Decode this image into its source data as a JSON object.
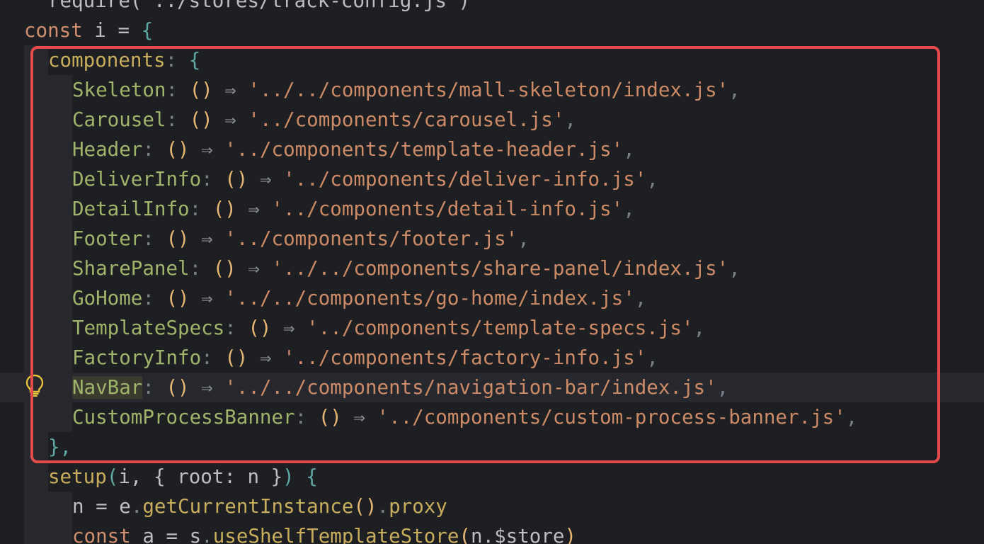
{
  "editor": {
    "lines": [
      {
        "text": "require('../stores/track-config.js')"
      },
      {
        "keyword": "const",
        "name": "i",
        "op": "=",
        "open": "{"
      },
      {
        "prop": "components",
        "open": "{"
      },
      {
        "prop": "Skeleton",
        "path": "'../../components/mall-skeleton/index.js'"
      },
      {
        "prop": "Carousel",
        "path": "'../components/carousel.js'"
      },
      {
        "prop": "Header",
        "path": "'../components/template-header.js'"
      },
      {
        "prop": "DeliverInfo",
        "path": "'../components/deliver-info.js'"
      },
      {
        "prop": "DetailInfo",
        "path": "'../components/detail-info.js'"
      },
      {
        "prop": "Footer",
        "path": "'../components/footer.js'"
      },
      {
        "prop": "SharePanel",
        "path": "'../../components/share-panel/index.js'"
      },
      {
        "prop": "GoHome",
        "path": "'../../components/go-home/index.js'"
      },
      {
        "prop": "TemplateSpecs",
        "path": "'../components/template-specs.js'"
      },
      {
        "prop": "FactoryInfo",
        "path": "'../components/factory-info.js'"
      },
      {
        "prop": "NavBar",
        "path": "'../../components/navigation-bar/index.js'"
      },
      {
        "prop": "CustomProcessBanner",
        "path": "'../components/custom-process-banner.js'"
      },
      {
        "close": "},"
      },
      {
        "method": "setup",
        "args": "i, { root: n }",
        "open": "{"
      },
      {
        "lhs": "n",
        "op": "=",
        "obj": "e",
        "call": "getCurrentInstance",
        "tail": "proxy"
      },
      {
        "keyword": "const",
        "name": "a",
        "op": "=",
        "obj": "s",
        "call": "useShelfTemplateStore",
        "arg": "n.$store"
      }
    ],
    "entry_punct": {
      "colon": ":",
      "params": "()",
      "arrow": "⇒",
      "comma": ","
    }
  },
  "colors": {
    "background": "#1e1f22",
    "highlight_box": "#e34b4b",
    "string": "#cc8a66",
    "keyword": "#cf8e6d",
    "property": "#9fb46b",
    "brace": "#5fa8a3"
  },
  "icons": {
    "gutter": "lightbulb-icon"
  }
}
